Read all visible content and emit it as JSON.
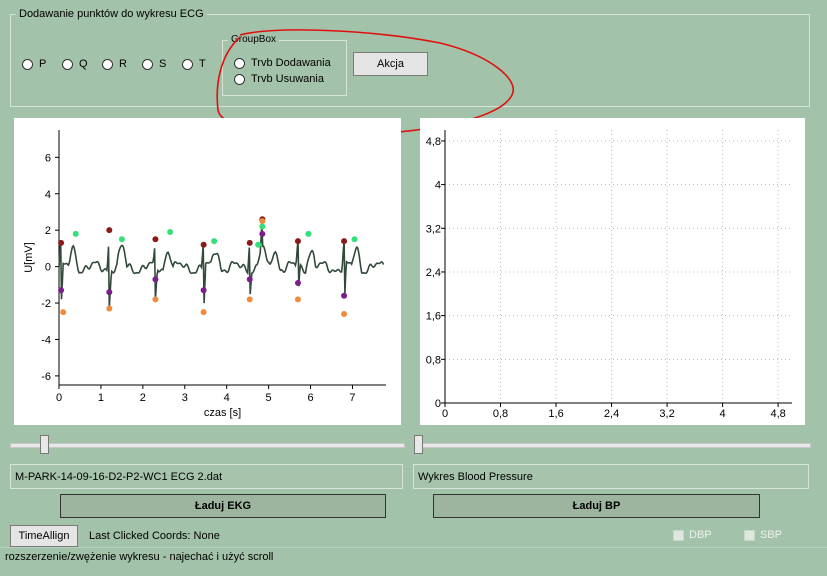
{
  "groupbox_main": {
    "title": "Dodawanie punktów do wykresu ECG"
  },
  "points": [
    {
      "label": "P"
    },
    {
      "label": "Q"
    },
    {
      "label": "R"
    },
    {
      "label": "S"
    },
    {
      "label": "T"
    }
  ],
  "groupbox_inner": {
    "title": "GroupBox"
  },
  "modes": [
    {
      "label": "Trvb Dodawania"
    },
    {
      "label": "Trvb Usuwania"
    }
  ],
  "action_button": "Akcja",
  "ecg_chart": {
    "type": "line",
    "xlabel": "czas [s]",
    "ylabel": "U[mV]",
    "xlim": [
      0,
      7.8
    ],
    "ylim": [
      -6.5,
      7.5
    ],
    "xticks": [
      "0",
      "1",
      "2",
      "3",
      "4",
      "5",
      "6",
      "7"
    ],
    "yticks": [
      "-6",
      "-4",
      "-2",
      "0",
      "2",
      "4",
      "6"
    ],
    "line_color": "#324a3a"
  },
  "bp_chart": {
    "type": "line",
    "xlim": [
      0,
      5.0
    ],
    "ylim": [
      0,
      5.0
    ],
    "xticks": [
      "0",
      "0,8",
      "1,6",
      "2,4",
      "3,2",
      "4",
      "4,8"
    ],
    "yticks": [
      "0",
      "0,8",
      "1,6",
      "2,4",
      "3,2",
      "4",
      "4,8"
    ],
    "grid": true
  },
  "chart_data": {
    "type": "line",
    "x_label": "czas [s]",
    "y_label": "U[mV]",
    "series": [
      {
        "name": "P",
        "color": "#8b1a1a",
        "x": [
          0.05,
          1.2,
          2.3,
          3.45,
          4.55,
          4.85,
          5.7,
          6.8
        ],
        "y": [
          1.3,
          2.0,
          1.5,
          1.2,
          1.3,
          2.6,
          1.4,
          1.4
        ]
      },
      {
        "name": "Q",
        "color": "#7a1f8a",
        "x": [
          0.05,
          1.2,
          2.3,
          3.45,
          4.55,
          4.85,
          5.7,
          6.8
        ],
        "y": [
          -1.3,
          -1.4,
          -0.7,
          -1.3,
          -0.7,
          1.8,
          -0.9,
          -1.6
        ]
      },
      {
        "name": "S",
        "color": "#f08a3c",
        "x": [
          0.1,
          1.2,
          2.3,
          3.45,
          4.55,
          4.85,
          5.7,
          6.8
        ],
        "y": [
          -2.5,
          -2.3,
          -1.8,
          -2.5,
          -1.8,
          2.5,
          -1.8,
          -2.6
        ]
      },
      {
        "name": "T",
        "color": "#33e07a",
        "x": [
          0.4,
          1.5,
          2.65,
          3.7,
          4.75,
          4.85,
          5.95,
          7.05
        ],
        "y": [
          1.8,
          1.5,
          1.9,
          1.4,
          1.2,
          2.2,
          1.8,
          1.5
        ]
      }
    ]
  },
  "file_field": "M-PARK-14-09-16-D2-P2-WC1 ECG 2.dat",
  "bp_field": "Wykres Blood Pressure",
  "load_ekg": "Ładuj EKG",
  "load_bp": "Ładuj BP",
  "time_allign": "TimeAllign",
  "coords": "Last Clicked Coords: None",
  "dbp": "DBP",
  "sbp": "SBP",
  "status": "rozszerzenie/zwężenie wykresu - najechać i użyć scroll",
  "slider_left": {
    "value": 0.1
  },
  "slider_right": {
    "value": 0.0
  }
}
